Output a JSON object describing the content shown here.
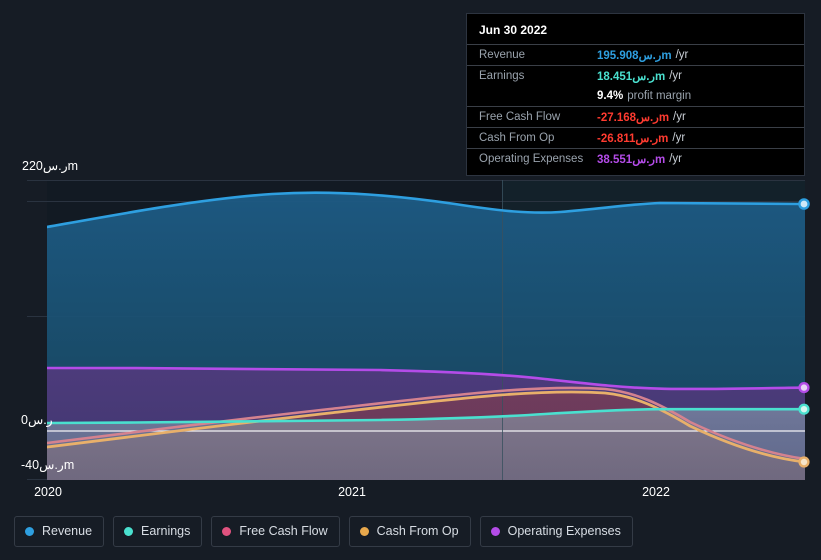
{
  "currency_symbol": "ر.س",
  "colors": {
    "background": "#161c25",
    "revenue": "#2e9fe0",
    "earnings": "#4ae0cf",
    "free_cash_flow": "#e0527f",
    "cash_from_op": "#e8a84c",
    "operating_expenses": "#b44ce8",
    "zero_line": "#ffffff",
    "grid": "#2a3340",
    "tooltip_bg": "#000000",
    "negative_value": "#ff3b30"
  },
  "tooltip": {
    "title": "Jun 30 2022",
    "rows": [
      {
        "label": "Revenue",
        "value": "195.908ر.س‎m",
        "suffix": "/yr",
        "color": "#2e9fe0"
      },
      {
        "label": "Earnings",
        "value": "18.451ر.س‎m",
        "suffix": "/yr",
        "color": "#4ae0cf"
      },
      {
        "label": "",
        "value": "9.4%",
        "suffix": "profit margin",
        "color": "#ffffff",
        "is_margin": true
      },
      {
        "label": "Free Cash Flow",
        "value": "-27.168ر.س‎m",
        "suffix": "/yr",
        "color": "#ff3b30"
      },
      {
        "label": "Cash From Op",
        "value": "-26.811ر.س‎m",
        "suffix": "/yr",
        "color": "#ff3b30"
      },
      {
        "label": "Operating Expenses",
        "value": "38.551ر.س‎m",
        "suffix": "/yr",
        "color": "#b44ce8"
      }
    ]
  },
  "legend": {
    "items": [
      {
        "label": "Revenue",
        "color": "#2e9fe0"
      },
      {
        "label": "Earnings",
        "color": "#4ae0cf"
      },
      {
        "label": "Free Cash Flow",
        "color": "#e0527f"
      },
      {
        "label": "Cash From Op",
        "color": "#e8a84c"
      },
      {
        "label": "Operating Expenses",
        "color": "#b44ce8"
      }
    ]
  },
  "axes": {
    "y_top_label": "220ر.س‎m",
    "y_zero_label": "0ر.س",
    "y_bottom_label": "-40ر.س‎m",
    "x_labels": [
      "2020",
      "2021",
      "2022"
    ]
  },
  "chart_data": {
    "type": "area",
    "title": "",
    "xlabel": "",
    "ylabel": "ر.س m",
    "ylim": [
      -40,
      220
    ],
    "y_ticks": [
      220,
      0,
      -40
    ],
    "x_ticks": [
      "2020",
      "2021",
      "2022"
    ],
    "grid": true,
    "legend_position": "bottom",
    "units": "ر.س millions per year",
    "annotation": "Vertical divider near mid-2020 separates reported from forecast region",
    "x": [
      "2020-01",
      "2020-04",
      "2020-07",
      "2020-10",
      "2021-01",
      "2021-04",
      "2021-07",
      "2021-10",
      "2022-01",
      "2022-04",
      "2022-06"
    ],
    "series": [
      {
        "name": "Revenue",
        "color": "#2e9fe0",
        "values": [
          179,
          188,
          198,
          206,
          207,
          200,
          192,
          189,
          194,
          196,
          195.908
        ]
      },
      {
        "name": "Earnings",
        "color": "#4ae0cf",
        "values": [
          7,
          7.5,
          8,
          8.5,
          9,
          9.5,
          10,
          11,
          17,
          18.3,
          18.451
        ]
      },
      {
        "name": "Free Cash Flow",
        "color": "#e0527f",
        "values": [
          -33,
          -26,
          -19,
          -11,
          -3,
          4,
          9,
          10,
          -3,
          -20,
          -27.168
        ]
      },
      {
        "name": "Cash From Op",
        "color": "#e8a84c",
        "values": [
          -32,
          -25,
          -18,
          -10,
          -2,
          5,
          10,
          11,
          -2,
          -19,
          -26.811
        ]
      },
      {
        "name": "Operating Expenses",
        "color": "#b44ce8",
        "values": [
          55,
          55,
          55,
          54,
          53,
          50,
          46,
          41,
          38,
          38.4,
          38.551
        ]
      }
    ]
  }
}
